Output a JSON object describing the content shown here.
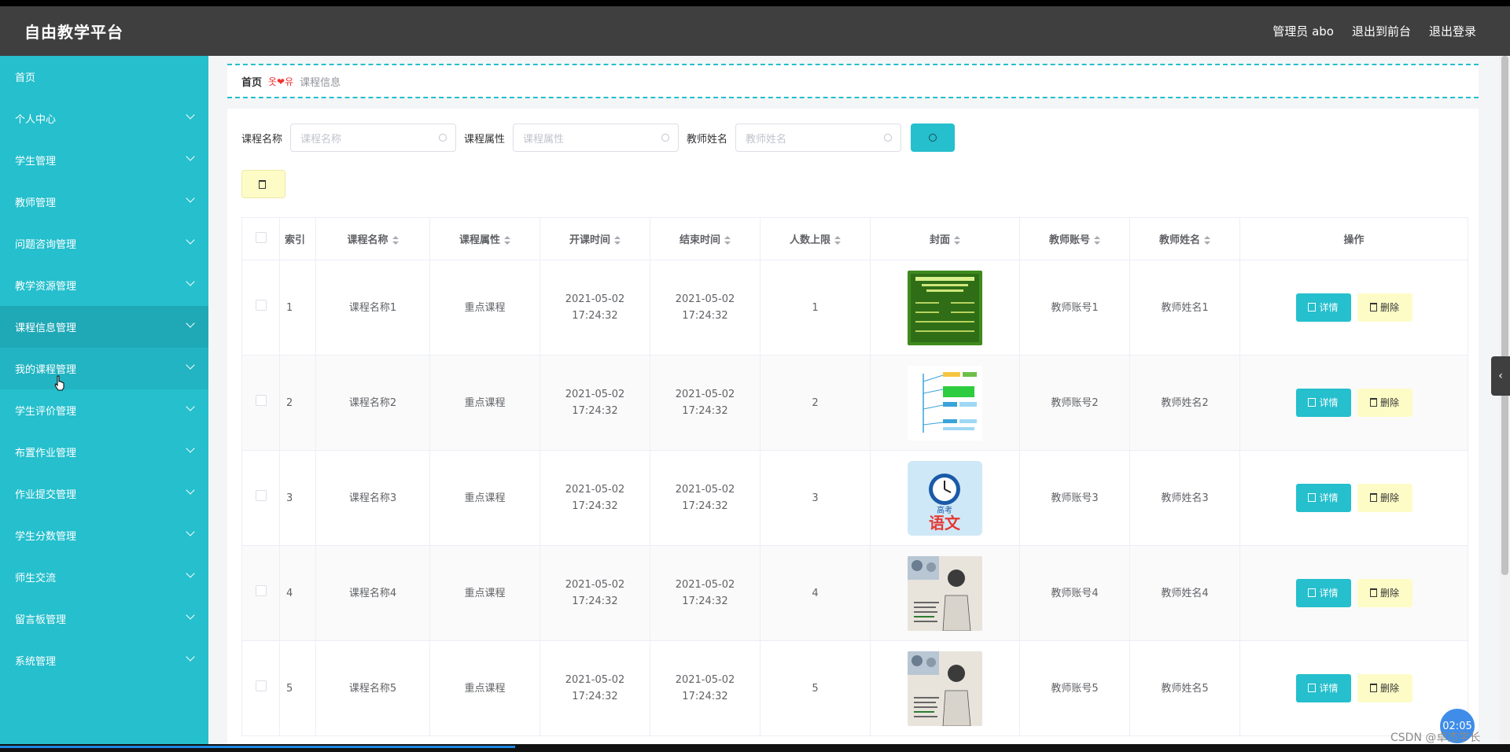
{
  "app": {
    "title": "自由教学平台"
  },
  "header": {
    "links": [
      "管理员 abo",
      "退出到前台",
      "退出登录"
    ]
  },
  "sidebar": {
    "items": [
      {
        "label": "首页",
        "has_children": false
      },
      {
        "label": "个人中心",
        "has_children": true
      },
      {
        "label": "学生管理",
        "has_children": true
      },
      {
        "label": "教师管理",
        "has_children": true
      },
      {
        "label": "问题咨询管理",
        "has_children": true
      },
      {
        "label": "教学资源管理",
        "has_children": true
      },
      {
        "label": "课程信息管理",
        "has_children": true,
        "active": true
      },
      {
        "label": "我的课程管理",
        "has_children": true,
        "hover": true
      },
      {
        "label": "学生评价管理",
        "has_children": true
      },
      {
        "label": "布置作业管理",
        "has_children": true
      },
      {
        "label": "作业提交管理",
        "has_children": true
      },
      {
        "label": "学生分数管理",
        "has_children": true
      },
      {
        "label": "师生交流",
        "has_children": true
      },
      {
        "label": "留言板管理",
        "has_children": true
      },
      {
        "label": "系统管理",
        "has_children": true
      }
    ]
  },
  "breadcrumb": {
    "home": "首页",
    "separator": "옷❤유",
    "current": "课程信息"
  },
  "search": {
    "fields": [
      {
        "label": "课程名称",
        "placeholder": "课程名称"
      },
      {
        "label": "课程属性",
        "placeholder": "课程属性"
      },
      {
        "label": "教师姓名",
        "placeholder": "教师姓名"
      }
    ]
  },
  "table": {
    "columns": [
      "索引",
      "课程名称",
      "课程属性",
      "开课时间",
      "结束时间",
      "人数上限",
      "封面",
      "教师账号",
      "教师姓名",
      "操作"
    ],
    "rows": [
      {
        "index": "1",
        "name": "课程名称1",
        "attr": "重点课程",
        "start": "2021-05-02 17:24:32",
        "end": "2021-05-02 17:24:32",
        "limit": "1",
        "cover": "green-poster",
        "account": "教师账号1",
        "teacher": "教师姓名1"
      },
      {
        "index": "2",
        "name": "课程名称2",
        "attr": "重点课程",
        "start": "2021-05-02 17:24:32",
        "end": "2021-05-02 17:24:32",
        "limit": "2",
        "cover": "mindmap",
        "account": "教师账号2",
        "teacher": "教师姓名2"
      },
      {
        "index": "3",
        "name": "课程名称3",
        "attr": "重点课程",
        "start": "2021-05-02 17:24:32",
        "end": "2021-05-02 17:24:32",
        "limit": "3",
        "cover": "clock-chinese",
        "account": "教师账号3",
        "teacher": "教师姓名3"
      },
      {
        "index": "4",
        "name": "课程名称4",
        "attr": "重点课程",
        "start": "2021-05-02 17:24:32",
        "end": "2021-05-02 17:24:32",
        "limit": "4",
        "cover": "portrait",
        "account": "教师账号4",
        "teacher": "教师姓名4"
      },
      {
        "index": "5",
        "name": "课程名称5",
        "attr": "重点课程",
        "start": "2021-05-02 17:24:32",
        "end": "2021-05-02 17:24:32",
        "limit": "5",
        "cover": "portrait",
        "account": "教师账号5",
        "teacher": "教师姓名5"
      }
    ],
    "actions": {
      "detail": "详情",
      "delete": "删除"
    }
  },
  "cover_texts": {
    "clock_label": "高考",
    "clock_big": "语文"
  },
  "overlay": {
    "timer": "02:05",
    "watermark": "CSDN @卓杰学长"
  },
  "colors": {
    "accent": "#25bfcd",
    "header": "#3f3f3f",
    "danger_bg": "#fdfcc7"
  }
}
